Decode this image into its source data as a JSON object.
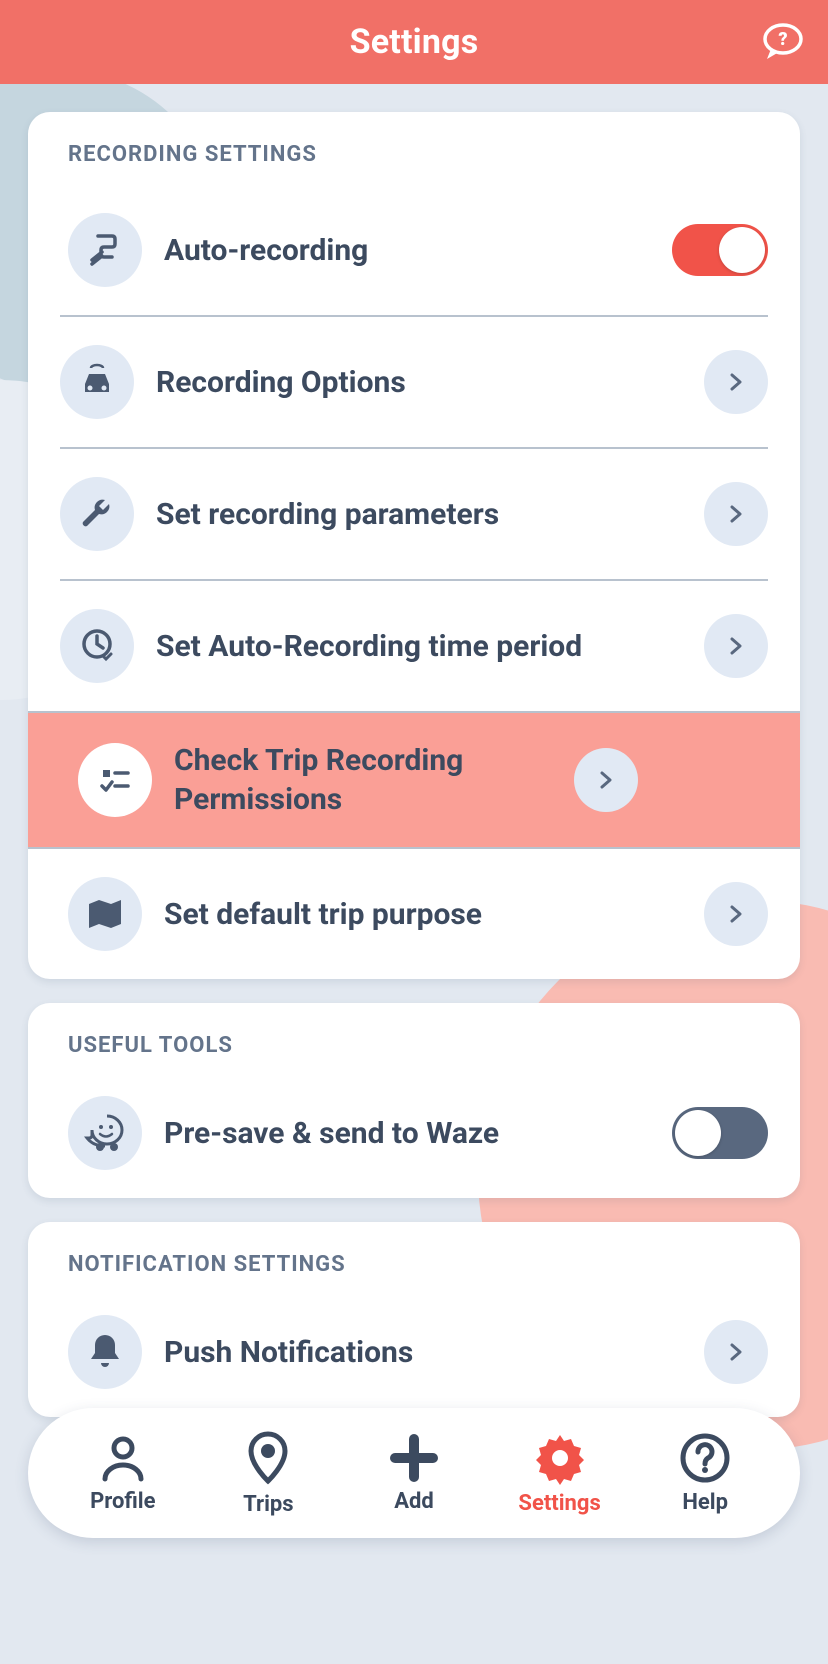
{
  "header": {
    "title": "Settings"
  },
  "sections": {
    "recording": {
      "title": "RECORDING SETTINGS",
      "auto_recording": "Auto-recording",
      "recording_options": "Recording Options",
      "set_params": "Set recording parameters",
      "set_time": "Set Auto-Recording time period",
      "check_permissions": "Check Trip Recording Permissions",
      "set_purpose": "Set default trip purpose",
      "toggle_on": true
    },
    "tools": {
      "title": "USEFUL TOOLS",
      "presave": "Pre-save & send to Waze",
      "toggle_on": false
    },
    "notifications": {
      "title": "NOTIFICATION SETTINGS",
      "push": "Push Notifications"
    }
  },
  "nav": {
    "profile": "Profile",
    "trips": "Trips",
    "add": "Add",
    "settings": "Settings",
    "help": "Help"
  },
  "colors": {
    "accent": "#F15349",
    "header": "#F17067",
    "text": "#3C4A5F",
    "muted": "#64748B"
  }
}
